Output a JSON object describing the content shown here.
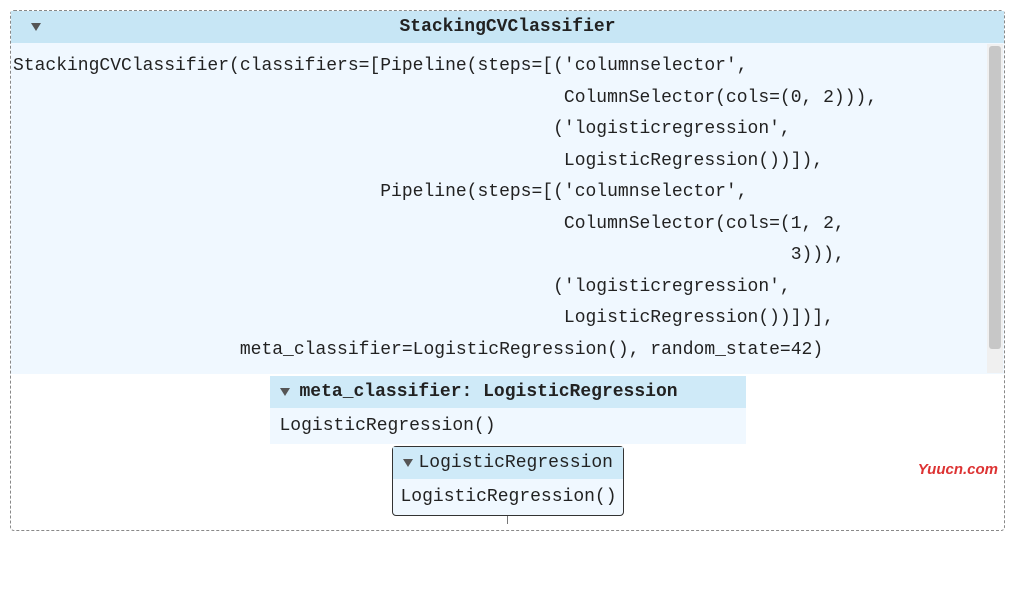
{
  "header": {
    "title": "StackingCVClassifier"
  },
  "code": {
    "l1": "StackingCVClassifier(classifiers=[Pipeline(steps=[('columnselector',",
    "l2": "                                                   ColumnSelector(cols=(0, 2))),",
    "l3": "                                                  ('logisticregression',",
    "l4": "                                                   LogisticRegression())]),",
    "l5": "                                  Pipeline(steps=[('columnselector',",
    "l6": "                                                   ColumnSelector(cols=(1, 2,",
    "l7": "                                                                        3))),",
    "l8": "                                                  ('logisticregression',",
    "l9": "                                                   LogisticRegression())])],",
    "l10": "                     meta_classifier=LogisticRegression(), random_state=42)"
  },
  "meta": {
    "header": "meta_classifier: LogisticRegression",
    "body": "LogisticRegression()"
  },
  "inner": {
    "header": "LogisticRegression",
    "body": "LogisticRegression()"
  },
  "watermark": "Yuucn.com"
}
